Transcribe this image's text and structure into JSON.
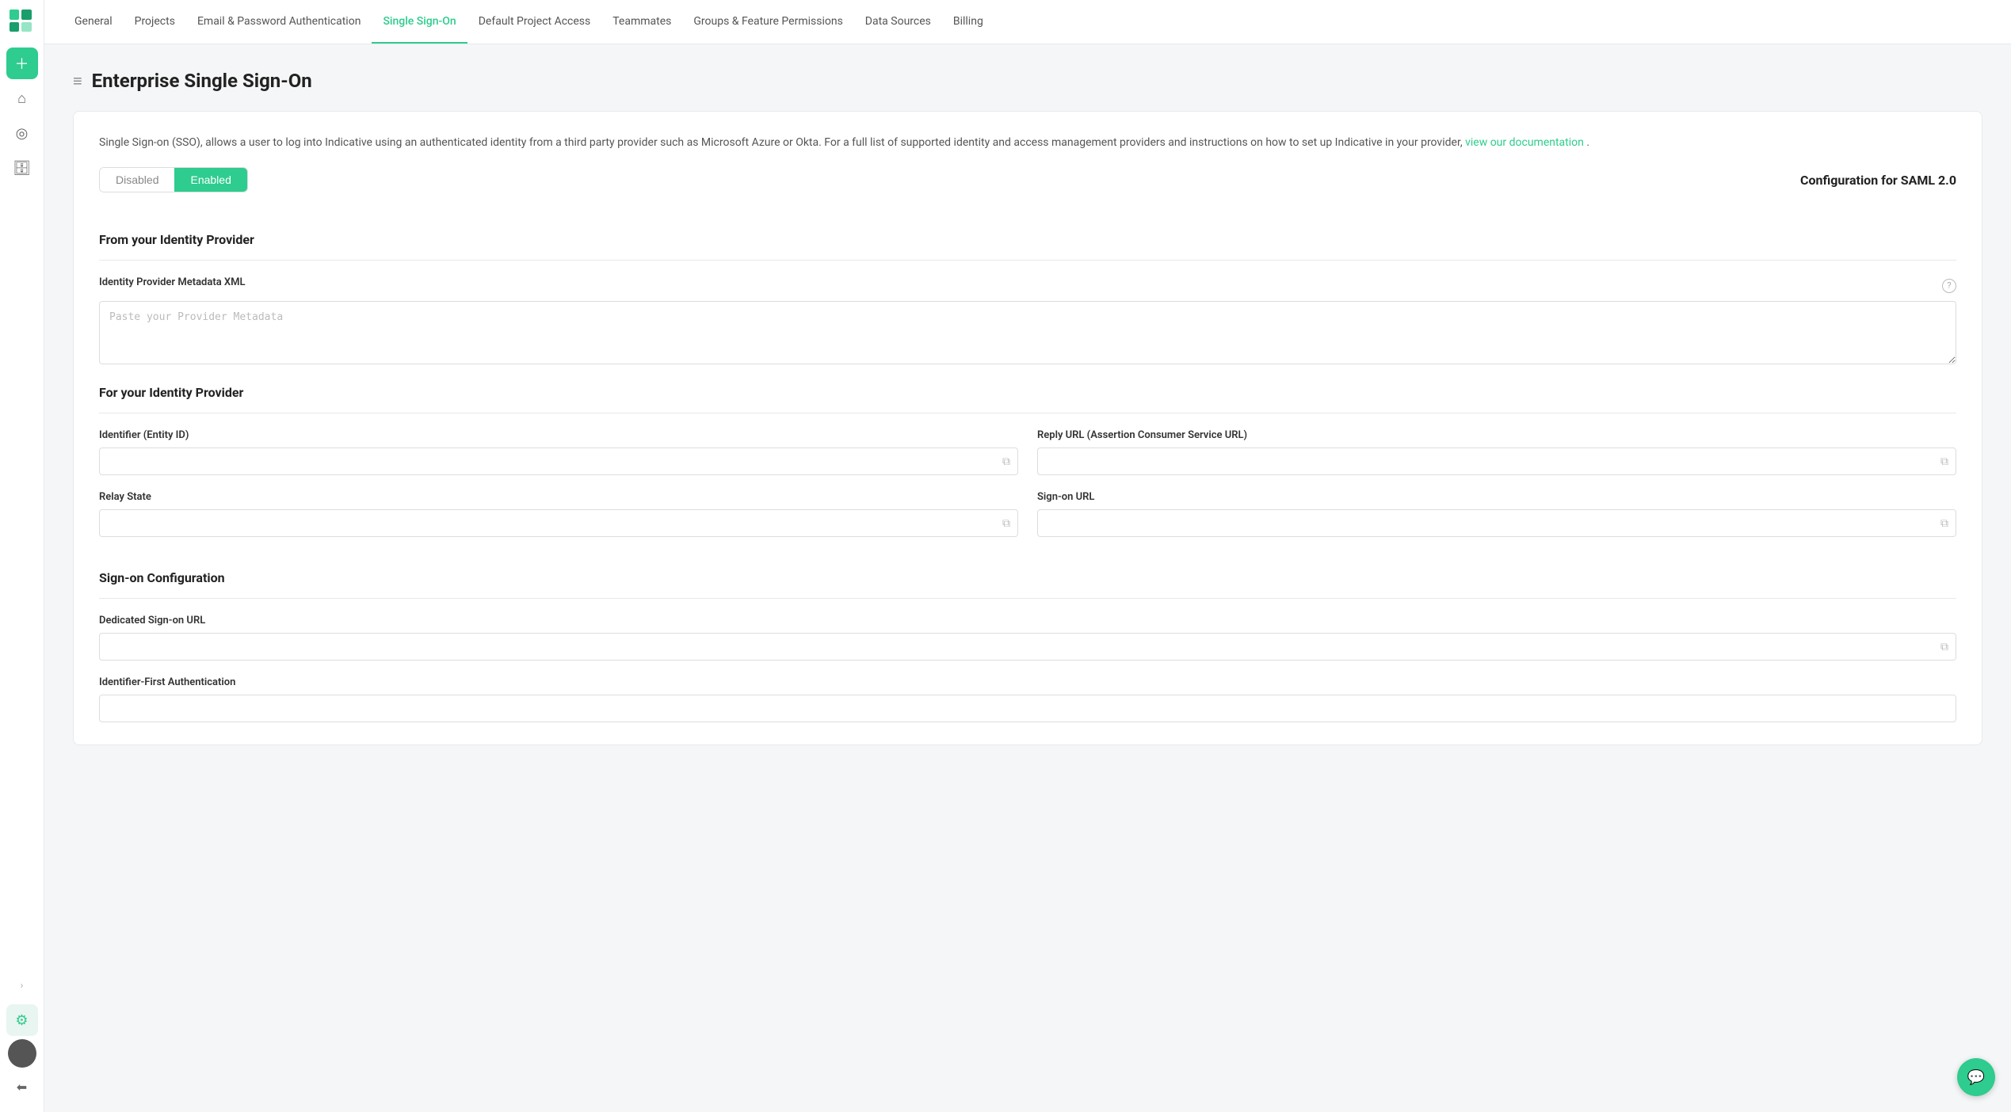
{
  "app": {
    "logo_alt": "Indicative Logo"
  },
  "sidebar": {
    "items": [
      {
        "icon": "➕",
        "label": "Add",
        "name": "add-button",
        "active": false,
        "green": true
      },
      {
        "icon": "🏠",
        "label": "Home",
        "name": "home-nav",
        "active": false
      },
      {
        "icon": "🧭",
        "label": "Explore",
        "name": "explore-nav",
        "active": false
      },
      {
        "icon": "📊",
        "label": "Data",
        "name": "data-nav",
        "active": false
      }
    ],
    "bottom_items": [
      {
        "icon": "›",
        "label": "Expand",
        "name": "expand-nav"
      },
      {
        "icon": "⚙",
        "label": "Settings",
        "name": "settings-nav",
        "active": true
      },
      {
        "icon": "👤",
        "label": "Profile",
        "name": "profile-nav"
      },
      {
        "icon": "←",
        "label": "Back",
        "name": "back-nav"
      }
    ],
    "avatar_initials": ""
  },
  "top_nav": {
    "items": [
      {
        "label": "General",
        "name": "tab-general",
        "active": false
      },
      {
        "label": "Projects",
        "name": "tab-projects",
        "active": false
      },
      {
        "label": "Email & Password Authentication",
        "name": "tab-email-auth",
        "active": false
      },
      {
        "label": "Single Sign-On",
        "name": "tab-sso",
        "active": true
      },
      {
        "label": "Default Project Access",
        "name": "tab-default-project",
        "active": false
      },
      {
        "label": "Teammates",
        "name": "tab-teammates",
        "active": false
      },
      {
        "label": "Groups & Feature Permissions",
        "name": "tab-groups",
        "active": false
      },
      {
        "label": "Data Sources",
        "name": "tab-data-sources",
        "active": false
      },
      {
        "label": "Billing",
        "name": "tab-billing",
        "active": false
      }
    ]
  },
  "page": {
    "title": "Enterprise Single Sign-On",
    "title_icon": "≡",
    "description": "Single Sign-on (SSO), allows a user to log into Indicative using an authenticated identity from a third party provider such as Microsoft Azure or Okta. For a full list of supported identity and access management providers and instructions on how to set up Indicative in your provider,",
    "description_link_text": "view our documentation",
    "description_end": ".",
    "toggle": {
      "disabled_label": "Disabled",
      "enabled_label": "Enabled",
      "active": "enabled"
    },
    "config_label": "Configuration for SAML 2.0",
    "sections": [
      {
        "heading": "From your Identity Provider",
        "name": "from-identity-provider",
        "fields": [
          {
            "label": "Identity Provider Metadata XML",
            "name": "identity-provider-metadata-xml",
            "type": "textarea",
            "placeholder": "Paste your Provider Metadata",
            "value": "",
            "has_help": true,
            "full_width": true
          }
        ]
      },
      {
        "heading": "For your Identity Provider",
        "name": "for-identity-provider",
        "fields_rows": [
          [
            {
              "label": "Identifier (Entity ID)",
              "name": "identifier-entity-id",
              "type": "input",
              "placeholder": "",
              "value": "",
              "has_copy": true
            },
            {
              "label": "Reply URL (Assertion Consumer Service URL)",
              "name": "reply-url",
              "type": "input",
              "placeholder": "",
              "value": "",
              "has_copy": true
            }
          ],
          [
            {
              "label": "Relay State",
              "name": "relay-state",
              "type": "input",
              "placeholder": "",
              "value": "",
              "has_copy": true
            },
            {
              "label": "Sign-on URL",
              "name": "sign-on-url",
              "type": "input",
              "placeholder": "",
              "value": "",
              "has_copy": true
            }
          ]
        ]
      },
      {
        "heading": "Sign-on Configuration",
        "name": "sign-on-configuration",
        "fields": [
          {
            "label": "Dedicated Sign-on URL",
            "name": "dedicated-sign-on-url",
            "type": "input",
            "placeholder": "",
            "value": "",
            "has_copy": true,
            "full_width": true
          }
        ],
        "extra_fields": [
          {
            "label": "Identifier-First Authentication",
            "name": "identifier-first-auth",
            "type": "input",
            "placeholder": "",
            "value": ""
          }
        ]
      }
    ],
    "chat_btn_icon": "💬"
  }
}
